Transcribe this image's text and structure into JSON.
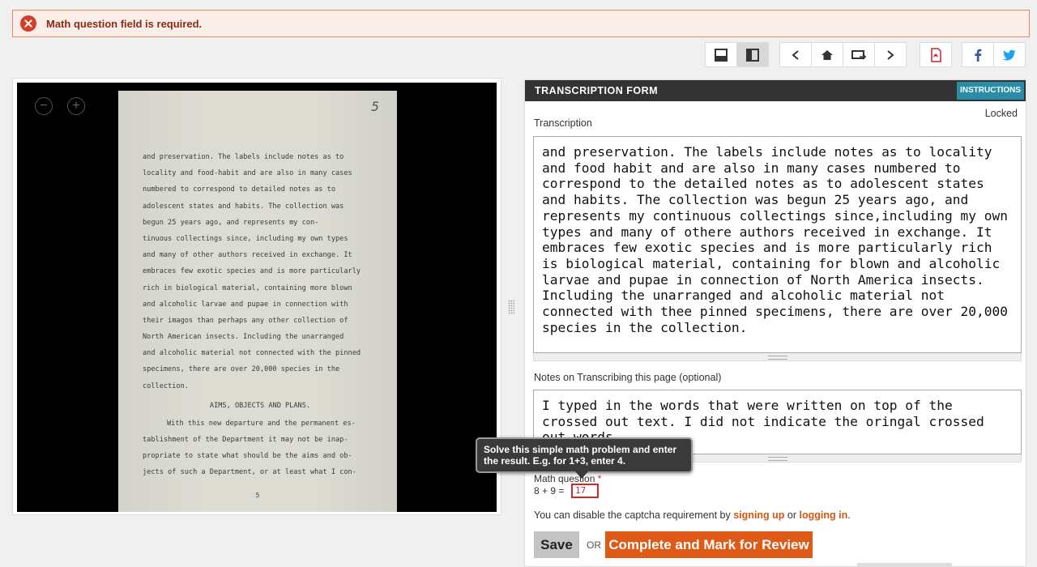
{
  "error": {
    "message": "Math question field is required."
  },
  "toolbar": {
    "buttons": [
      {
        "icon": "layout-horizontal-icon"
      },
      {
        "icon": "layout-vertical-icon"
      },
      {
        "icon": "chevron-left-icon"
      },
      {
        "icon": "home-icon"
      },
      {
        "icon": "return-icon"
      },
      {
        "icon": "chevron-right-icon"
      },
      {
        "icon": "pdf-icon"
      },
      {
        "icon": "facebook-icon"
      },
      {
        "icon": "twitter-icon"
      }
    ]
  },
  "document": {
    "page_mark": "5",
    "lines": [
      "and preservation.  The labels include notes as to",
      "locality and food-habit and are also in many cases",
      "numbered to correspond to  detailed notes as to",
      "adolescent states and habits.   The collection was",
      "begun 25 years ago, and represents my con-",
      "tinuous collectings since, including my own types",
      "and many of other authors received in exchange.  It",
      "embraces few exotic  species and is more particularly",
      "rich in biological material, containing more blown",
      "and alcoholic larvae and pupae in connection with",
      "their imagos than perhaps any other collection of",
      "North American insects.  Including the unarranged",
      "and alcoholic material not connected with the pinned",
      "specimens, there are over 20,000 species in the",
      "collection."
    ],
    "heading": "AIMS, OBJECTS AND PLANS.",
    "lines2": [
      "With this new departure and the  permanent  es-",
      "tablishment of the Department it  may not be inap-",
      "propriate to state what should be the aims and ob-",
      "jects of such a Department, or at least what I con-"
    ],
    "footer": "5"
  },
  "form": {
    "title": "TRANSCRIPTION FORM",
    "instructions": "INSTRUCTIONS",
    "transcription_label": "Transcription",
    "locked": "Locked",
    "transcription": "and preservation. The labels include notes as to locality and food habit and are also in many cases numbered to correspond to the detailed notes as to adolescent states and habits. The collection was begun 25 years ago, and represents my continuous collectings since,including my own types and many of othere authors received in exchange. It embraces few exotic species and is more particularly rich is biological material, containing for blown and alcoholic larvae and pupae in connection of North America insects. Including the unarranged and alcoholic material not connected with thee pinned specimens, there are over 20,000 species in the collection.",
    "notes_label": "Notes on Transcribing this page (optional)",
    "notes": "I typed in the words that were written on top of the crossed out text. I did not indicate the oringal crossed out words.",
    "math_label": "Math question",
    "math_required": "*",
    "math_problem": "8 + 9 =",
    "math_value": "17",
    "captcha_prefix": "You can disable the captcha requirement by",
    "signing_up": "signing up",
    "or_word": "or",
    "logging_in": "logging in",
    "period": ".",
    "save": "Save",
    "or_label": "OR",
    "complete": "Complete and Mark for Review"
  },
  "tooltip": {
    "text": "Solve this simple math problem and enter the result. E.g. for 1+3, enter 4."
  },
  "colors": {
    "accent": "#e05a17",
    "header": "#333333",
    "instructions": "#2a8ca6",
    "error": "#d93a2b"
  }
}
